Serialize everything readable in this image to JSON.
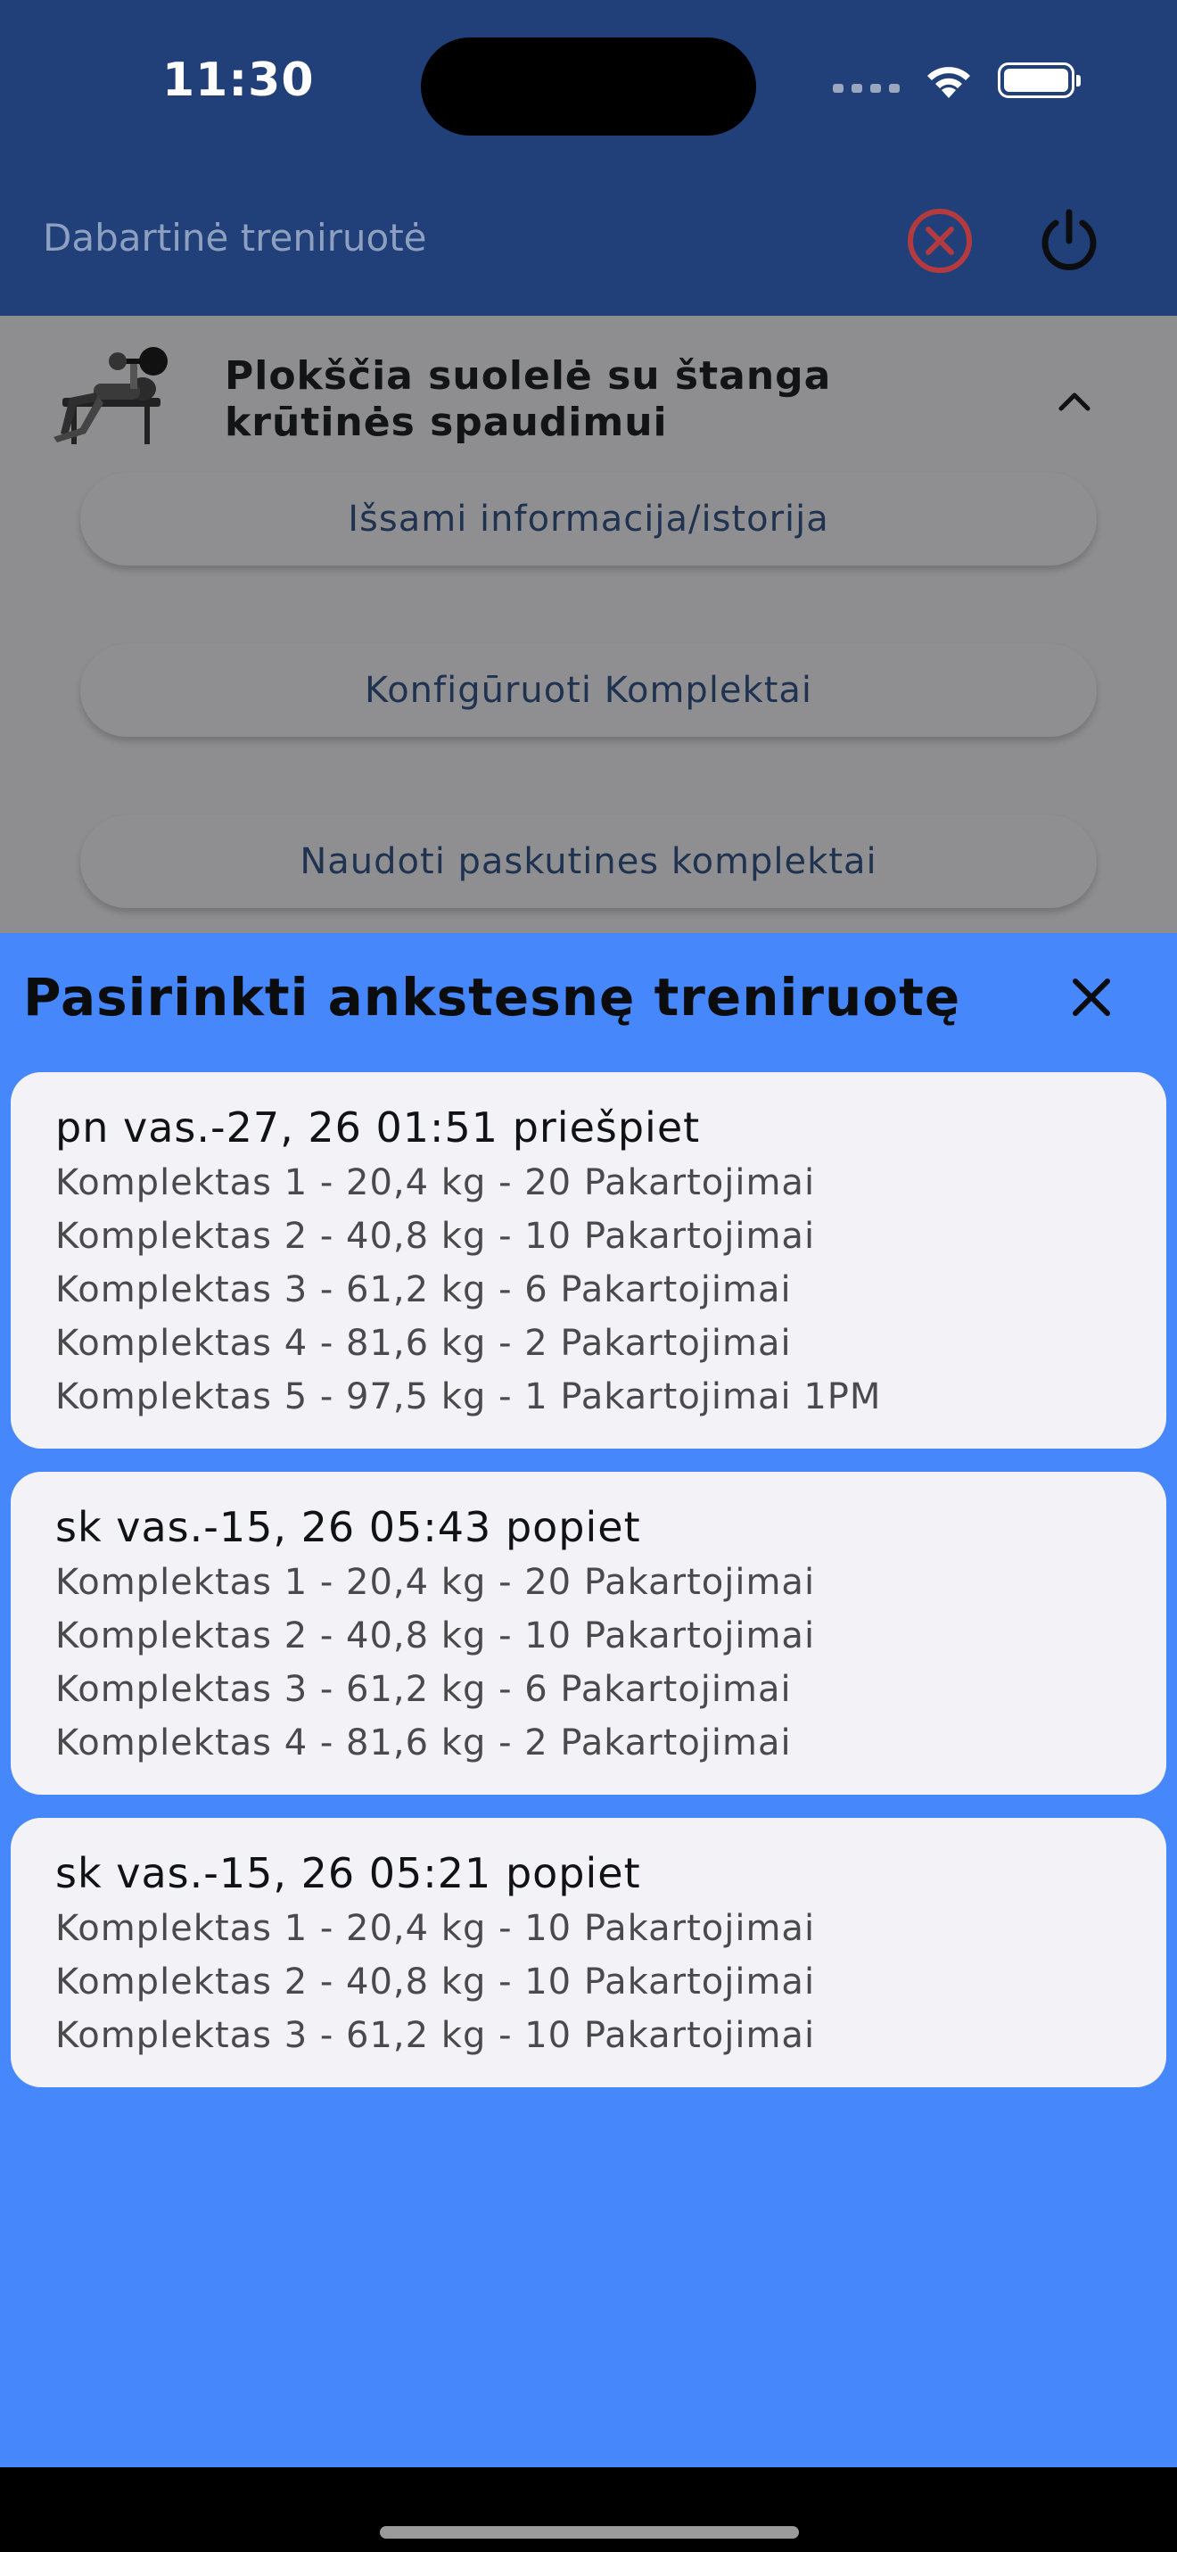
{
  "status_bar": {
    "time": "11:30"
  },
  "app_bar": {
    "title": "Dabartinė treniruotė",
    "cancel_icon": "circle-x-icon",
    "power_icon": "power-icon",
    "colors": {
      "background": "#21407a",
      "cancel": "#e0484b"
    }
  },
  "exercise": {
    "name": "Plokščia suolelė su štanga krūtinės spaudimui",
    "thumbnail_icon": "bench-press-figure-icon",
    "expand_icon": "chevron-up-icon"
  },
  "actions": {
    "details": "Išsami informacija/istorija",
    "configure": "Konfigūruoti Komplektai",
    "use_last": "Naudoti paskutines komplektai"
  },
  "sheet": {
    "title": "Pasirinkti ankstesnę treniruotę",
    "close_icon": "close-icon",
    "background": "#4688fc",
    "workouts": [
      {
        "date": "pn vas.-27, 26 01:51 priešpiet",
        "sets": [
          "Komplektas 1 - 20,4 kg - 20 Pakartojimai",
          "Komplektas 2 - 40,8 kg - 10 Pakartojimai",
          "Komplektas 3 - 61,2 kg - 6 Pakartojimai",
          "Komplektas 4 - 81,6 kg - 2 Pakartojimai",
          "Komplektas 5 - 97,5 kg - 1 Pakartojimai 1PM"
        ]
      },
      {
        "date": "sk vas.-15, 26 05:43 popiet",
        "sets": [
          "Komplektas 1 - 20,4 kg - 20 Pakartojimai",
          "Komplektas 2 - 40,8 kg - 10 Pakartojimai",
          "Komplektas 3 - 61,2 kg - 6 Pakartojimai",
          "Komplektas 4 - 81,6 kg - 2 Pakartojimai"
        ]
      },
      {
        "date": "sk vas.-15, 26 05:21 popiet",
        "sets": [
          "Komplektas 1 - 20,4 kg - 10 Pakartojimai",
          "Komplektas 2 - 40,8 kg - 10 Pakartojimai",
          "Komplektas 3 - 61,2 kg - 10 Pakartojimai"
        ]
      }
    ]
  }
}
